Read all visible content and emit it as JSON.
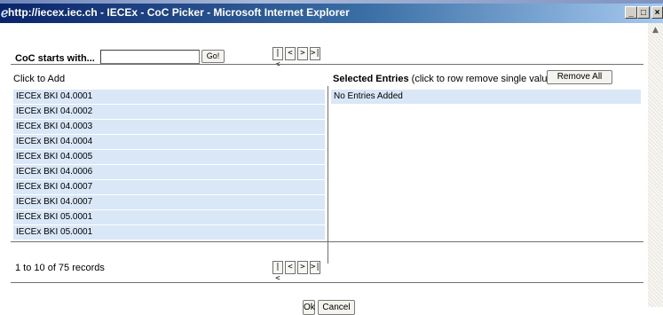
{
  "window": {
    "title": "http://iecex.iec.ch - IECEx - CoC Picker - Microsoft Internet Explorer",
    "controls": {
      "minimize": "_",
      "maximize": "□",
      "close": "×"
    }
  },
  "search": {
    "label": "CoC starts with...",
    "value": "",
    "go_label": "Go!"
  },
  "pager": {
    "first": "|<",
    "prev": "<",
    "next": ">",
    "last": ">|"
  },
  "left_panel": {
    "header": "Click to Add",
    "rows": [
      "IECEx BKI 04.0001",
      "IECEx BKI 04.0002",
      "IECEx BKI 04.0003",
      "IECEx BKI 04.0004",
      "IECEx BKI 04.0005",
      "IECEx BKI 04.0006",
      "IECEx BKI 04.0007",
      "IECEx BKI 04.0007",
      "IECEx BKI 05.0001",
      "IECEx BKI 05.0001"
    ]
  },
  "right_panel": {
    "header_bold": "Selected Entries",
    "header_rest": " (click to row remove single value)",
    "remove_all_label": "Remove All",
    "empty_text": "No Entries Added"
  },
  "records_text": "1 to 10 of 75 records",
  "footer": {
    "ok_label": "Ok",
    "cancel_label": "Cancel"
  },
  "colors": {
    "row_bg": "#d9e7f7",
    "titlebar_start": "#0a246a",
    "titlebar_end": "#a6caf0"
  }
}
